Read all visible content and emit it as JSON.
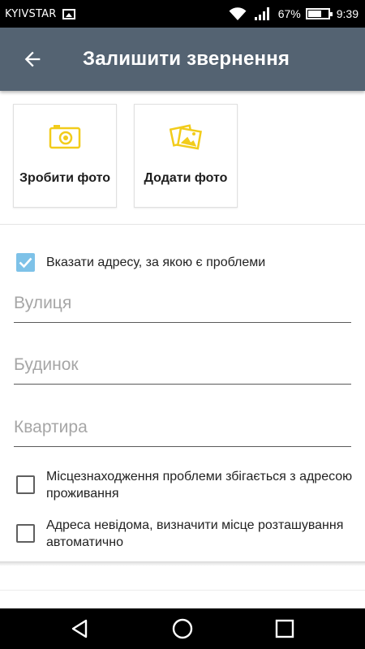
{
  "status_bar": {
    "carrier": "KYIVSTAR",
    "battery_percent": "67%",
    "time": "9:39",
    "icons": [
      "image-notification-icon",
      "wifi-icon",
      "signal-icon",
      "battery-icon"
    ]
  },
  "toolbar": {
    "title": "Залишити звернення",
    "back_icon": "arrow-back-icon"
  },
  "photo_actions": {
    "take_photo": {
      "label": "Зробити фото",
      "icon": "camera-icon"
    },
    "add_photo": {
      "label": "Додати фото",
      "icon": "gallery-icon"
    }
  },
  "address": {
    "specify_address": {
      "label": "Вказати адресу, за якою є проблеми",
      "checked": true
    },
    "street": {
      "placeholder": "Вулиця",
      "value": ""
    },
    "house": {
      "placeholder": "Будинок",
      "value": ""
    },
    "apartment": {
      "placeholder": "Квартира",
      "value": ""
    },
    "same_as_residence": {
      "label": "Місцезнаходження проблеми збігається з адресою проживання",
      "checked": false
    },
    "auto_location": {
      "label": "Адреса невідома, визначити місце розташування автоматично",
      "checked": false
    }
  },
  "colors": {
    "toolbar": "#546372",
    "accent_icon": "#f2cc1b",
    "checkbox_checked": "#7ec2e8"
  },
  "nav_bar": {
    "icons": [
      "nav-back-icon",
      "nav-home-icon",
      "nav-recents-icon"
    ]
  }
}
